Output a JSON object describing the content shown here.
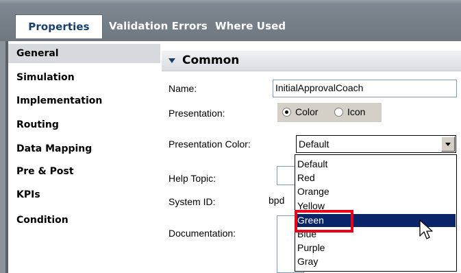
{
  "tabs": [
    {
      "label": "Properties",
      "active": true
    },
    {
      "label": "Validation Errors",
      "active": false
    },
    {
      "label": "Where Used",
      "active": false
    }
  ],
  "nav": {
    "items": [
      {
        "label": "General",
        "selected": true
      },
      {
        "label": "Simulation",
        "selected": false
      },
      {
        "label": "Implementation",
        "selected": false
      },
      {
        "label": "Routing",
        "selected": false
      },
      {
        "label": "Data Mapping",
        "selected": false
      },
      {
        "label": "Pre & Post",
        "selected": false
      },
      {
        "label": "KPIs",
        "selected": false
      },
      {
        "label": "Condition",
        "selected": false
      }
    ]
  },
  "section": {
    "title": "Common"
  },
  "form": {
    "name_label": "Name:",
    "name_value": "InitialApprovalCoach",
    "presentation_label": "Presentation:",
    "presentation_options": [
      {
        "label": "Color",
        "checked": true
      },
      {
        "label": "Icon",
        "checked": false
      }
    ],
    "presentation_color_label": "Presentation Color:",
    "presentation_color_value": "Default",
    "help_topic_label": "Help Topic:",
    "system_id_label": "System ID:",
    "system_id_value": "bpd",
    "documentation_label": "Documentation:"
  },
  "dropdown": {
    "options": [
      "Default",
      "Red",
      "Orange",
      "Yellow",
      "Green",
      "Blue",
      "Purple",
      "Gray"
    ],
    "highlighted": "Green"
  },
  "colors": {
    "highlight": "#0a246a",
    "annotation_box": "#e8001c",
    "tab_text_active": "#18406b"
  },
  "icons": {
    "section_toggle": "triangle-down-icon",
    "cursor": "mouse-pointer-icon"
  }
}
